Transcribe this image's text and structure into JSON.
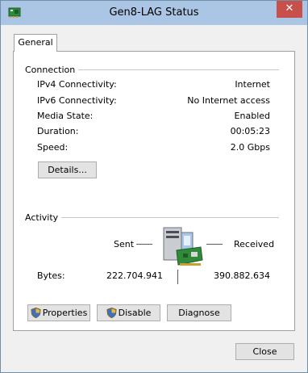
{
  "window": {
    "title": "Gen8-LAG Status",
    "close_glyph": "✕"
  },
  "tabs": [
    {
      "label": "General"
    }
  ],
  "connection": {
    "heading": "Connection",
    "rows": [
      {
        "label": "IPv4 Connectivity:",
        "value": "Internet"
      },
      {
        "label": "IPv6 Connectivity:",
        "value": "No Internet access"
      },
      {
        "label": "Media State:",
        "value": "Enabled"
      },
      {
        "label": "Duration:",
        "value": "00:05:23"
      },
      {
        "label": "Speed:",
        "value": "2.0 Gbps"
      }
    ],
    "details_label": "Details..."
  },
  "activity": {
    "heading": "Activity",
    "sent_label": "Sent",
    "received_label": "Received",
    "bytes_label": "Bytes:",
    "bytes_sent": "222.704.941",
    "bytes_received": "390.882.634",
    "icon": "network-computer-icon"
  },
  "buttons": {
    "properties": "Properties",
    "disable": "Disable",
    "diagnose": "Diagnose",
    "close": "Close"
  }
}
